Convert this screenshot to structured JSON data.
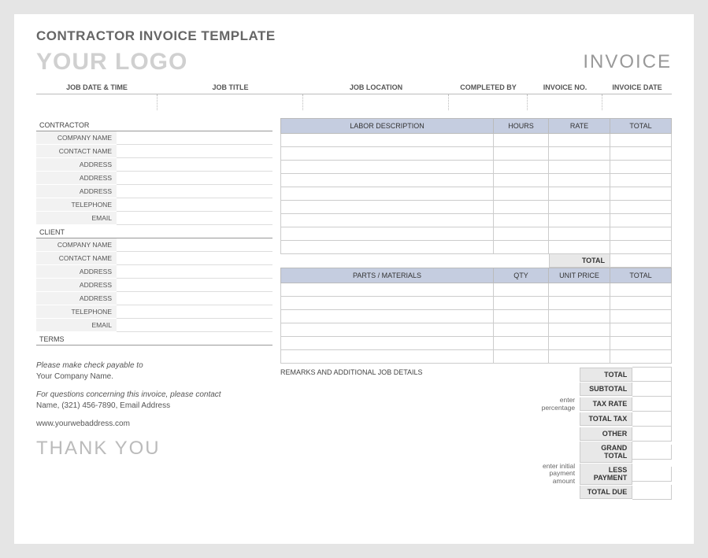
{
  "title": "CONTRACTOR INVOICE TEMPLATE",
  "logo": "YOUR LOGO",
  "invoice_word": "INVOICE",
  "job_headers": {
    "date_time": "JOB DATE & TIME",
    "title": "JOB TITLE",
    "location": "JOB LOCATION",
    "completed_by": "COMPLETED BY",
    "invoice_no": "INVOICE NO.",
    "invoice_date": "INVOICE DATE"
  },
  "sections": {
    "contractor": "CONTRACTOR",
    "client": "CLIENT",
    "terms": "TERMS"
  },
  "fields": {
    "company_name": "COMPANY NAME",
    "contact_name": "CONTACT NAME",
    "address": "ADDRESS",
    "telephone": "TELEPHONE",
    "email": "EMAIL"
  },
  "labor": {
    "description": "LABOR DESCRIPTION",
    "hours": "HOURS",
    "rate": "RATE",
    "total": "TOTAL",
    "total_label": "TOTAL"
  },
  "parts": {
    "description": "PARTS / MATERIALS",
    "qty": "QTY",
    "unit_price": "UNIT PRICE",
    "total": "TOTAL"
  },
  "remarks_label": "REMARKS AND ADDITIONAL JOB DETAILS",
  "summary": {
    "total": "TOTAL",
    "subtotal": "SUBTOTAL",
    "tax_rate": "TAX RATE",
    "total_tax": "TOTAL TAX",
    "other": "OTHER",
    "grand_total": "GRAND TOTAL",
    "less_payment": "LESS PAYMENT",
    "total_due": "TOTAL DUE",
    "hint_percentage": "enter percentage",
    "hint_payment_1": "enter initial",
    "hint_payment_2": "payment amount"
  },
  "footer": {
    "payable_italic": "Please make check payable to",
    "payable_name": "Your Company Name.",
    "questions_italic": "For questions concerning this invoice, please contact",
    "contact_line": "Name, (321) 456-7890, Email Address",
    "website": "www.yourwebaddress.com",
    "thank_you": "THANK YOU"
  }
}
